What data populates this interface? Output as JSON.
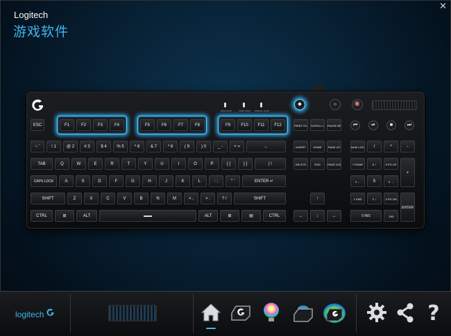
{
  "window": {
    "close_label": "✕"
  },
  "header": {
    "brand": "Logitech",
    "subtitle": "游戏软件"
  },
  "keyboard": {
    "indicators": [
      "NUM LOCK",
      "CAPS LOCK",
      "SCROLL LOCK"
    ],
    "media": {
      "mute": "🔇",
      "rew": "⏮",
      "play": "⏯",
      "stop": "■",
      "fwd": "⏭"
    },
    "rows": {
      "esc": "ESC",
      "f1": "F1",
      "f2": "F2",
      "f3": "F3",
      "f4": "F4",
      "f5": "F5",
      "f6": "F6",
      "f7": "F7",
      "f8": "F8",
      "f9": "F9",
      "f10": "F10",
      "f11": "F11",
      "f12": "F12",
      "prtsc": "PRINT SCREEN",
      "scroll": "SCROLL LOCK",
      "pause": "PAUSE BREAK",
      "tilde": "~ `",
      "n1": "! 1",
      "n2": "@ 2",
      "n3": "# 3",
      "n4": "$ 4",
      "n5": "% 5",
      "n6": "^ 6",
      "n7": "& 7",
      "n8": "* 8",
      "n9": "( 9",
      "n0": ") 0",
      "minus": "_ -",
      "equal": "+ =",
      "backspace": "←",
      "insert": "INSERT",
      "home": "HOME",
      "pgup": "PAGE UP",
      "numlock": "NUM LOCK",
      "ndiv": "/",
      "nmul": "*",
      "nminus": "-",
      "tab": "TAB",
      "q": "Q",
      "w": "W",
      "e": "E",
      "r": "R",
      "t": "T",
      "y": "Y",
      "u": "U",
      "i": "I",
      "o": "O",
      "p": "P",
      "lbr": "{ [",
      "rbr": "} ]",
      "bslash": "| \\",
      "delete": "DELETE",
      "end": "END",
      "pgdn": "PAGE DOWN",
      "n7k": "7 HOME",
      "n8k": "8 ↑",
      "n9k": "9 PG UP",
      "nplus": "+",
      "caps": "CAPS LOCK",
      "a": "A",
      "s": "S",
      "d": "D",
      "f": "F",
      "g": "G",
      "h": "H",
      "j": "J",
      "k": "K",
      "l": "L",
      "semi": ": ;",
      "quote": "\" '",
      "enter": "ENTER ↵",
      "n4k": "4 ←",
      "n5k": "5",
      "n6k": "6 →",
      "lshift": "SHIFT",
      "z": "Z",
      "x": "X",
      "c": "C",
      "v": "V",
      "b": "B",
      "n": "N",
      "m": "M",
      "comma": "< ,",
      "period": "> .",
      "slash": "? /",
      "rshift": "SHIFT",
      "up": "↑",
      "n1k": "1 END",
      "n2k": "2 ↓",
      "n3k": "3 PG DN",
      "nenter": "ENTER",
      "lctrl": "CTRL",
      "lwin": "⊞",
      "lalt": "ALT",
      "space": "▬▬",
      "ralt": "ALT",
      "rwin": "⊞",
      "menu": "▤",
      "rctrl": "CTRL",
      "left": "←",
      "down": "↓",
      "right": "→",
      "n0k": "0 INS",
      "ndel": ". DEL"
    }
  },
  "footer": {
    "brand": "logitech"
  }
}
